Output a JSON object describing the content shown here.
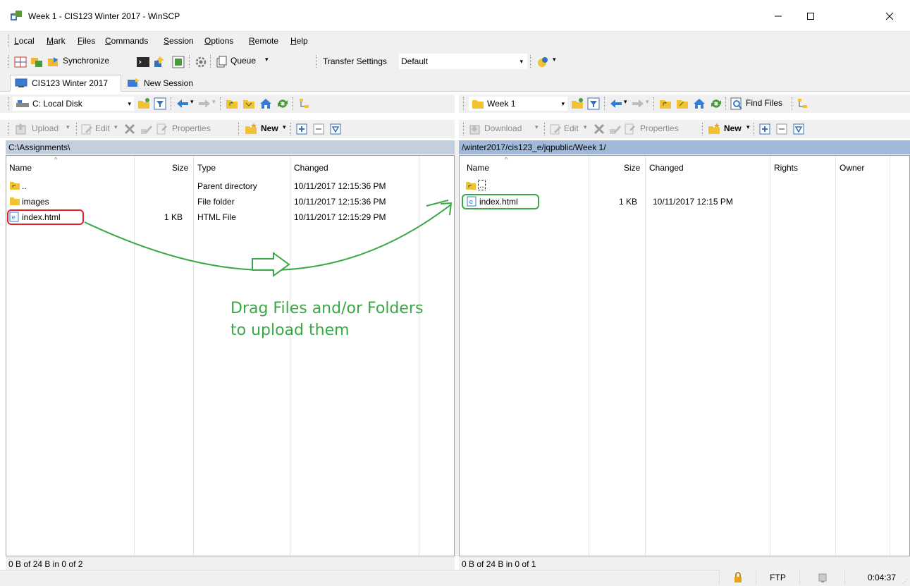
{
  "window": {
    "title": "Week 1 - CIS123 Winter 2017 - WinSCP",
    "minimize_icon": "minimize-icon",
    "maximize_icon": "maximize-icon",
    "close_icon": "close-icon"
  },
  "menu": [
    {
      "label": "Local",
      "u": "L",
      "rest": "ocal"
    },
    {
      "label": "Mark",
      "u": "M",
      "rest": "ark"
    },
    {
      "label": "Files",
      "u": "F",
      "rest": "iles"
    },
    {
      "label": "Commands",
      "u": "C",
      "rest": "ommands"
    },
    {
      "label": "Session",
      "u": "S",
      "rest": "ession"
    },
    {
      "label": "Options",
      "u": "O",
      "rest": "ptions"
    },
    {
      "label": "Remote",
      "u": "R",
      "rest": "emote"
    },
    {
      "label": "Help",
      "u": "H",
      "rest": "elp"
    }
  ],
  "toolbar": {
    "synchronize_label": "Synchronize",
    "queue_label": "Queue",
    "transfer_settings_label": "Transfer Settings",
    "transfer_settings_value": "Default"
  },
  "tabs": [
    {
      "label": "CIS123 Winter 2017"
    },
    {
      "label": "New Session"
    }
  ],
  "local": {
    "drive_label": "C: Local Disk",
    "upload_label": "Upload",
    "edit_label": "Edit",
    "properties_label": "Properties",
    "new_label": "New",
    "path": "C:\\Assignments\\",
    "columns": {
      "name": "Name",
      "size": "Size",
      "type": "Type",
      "changed": "Changed"
    },
    "rows": [
      {
        "name": "..",
        "size": "",
        "type": "Parent directory",
        "changed": "10/11/2017  12:15:36 PM"
      },
      {
        "name": "images",
        "size": "",
        "type": "File folder",
        "changed": "10/11/2017  12:15:36 PM"
      },
      {
        "name": "index.html",
        "size": "1 KB",
        "type": "HTML File",
        "changed": "10/11/2017  12:15:29 PM"
      }
    ],
    "status": "0 B of 24 B in 0 of 2"
  },
  "remote": {
    "folder_label": "Week 1",
    "find_files_label": "Find Files",
    "download_label": "Download",
    "edit_label": "Edit",
    "properties_label": "Properties",
    "new_label": "New",
    "path": "/winter2017/cis123_e/jqpublic/Week 1/",
    "columns": {
      "name": "Name",
      "size": "Size",
      "changed": "Changed",
      "rights": "Rights",
      "owner": "Owner"
    },
    "rows": [
      {
        "name": "..",
        "size": "",
        "changed": ""
      },
      {
        "name": "index.html",
        "size": "1 KB",
        "changed": "10/11/2017 12:15 PM"
      }
    ],
    "status": "0 B of 24 B in 0 of 1"
  },
  "statusbar": {
    "protocol": "FTP",
    "time": "0:04:37"
  },
  "annotation": {
    "line1": "Drag Files and/or Folders",
    "line2": "to upload them",
    "color": "#3aa846",
    "local_highlight_color": "#e0202a",
    "remote_highlight_color": "#3aa846"
  }
}
